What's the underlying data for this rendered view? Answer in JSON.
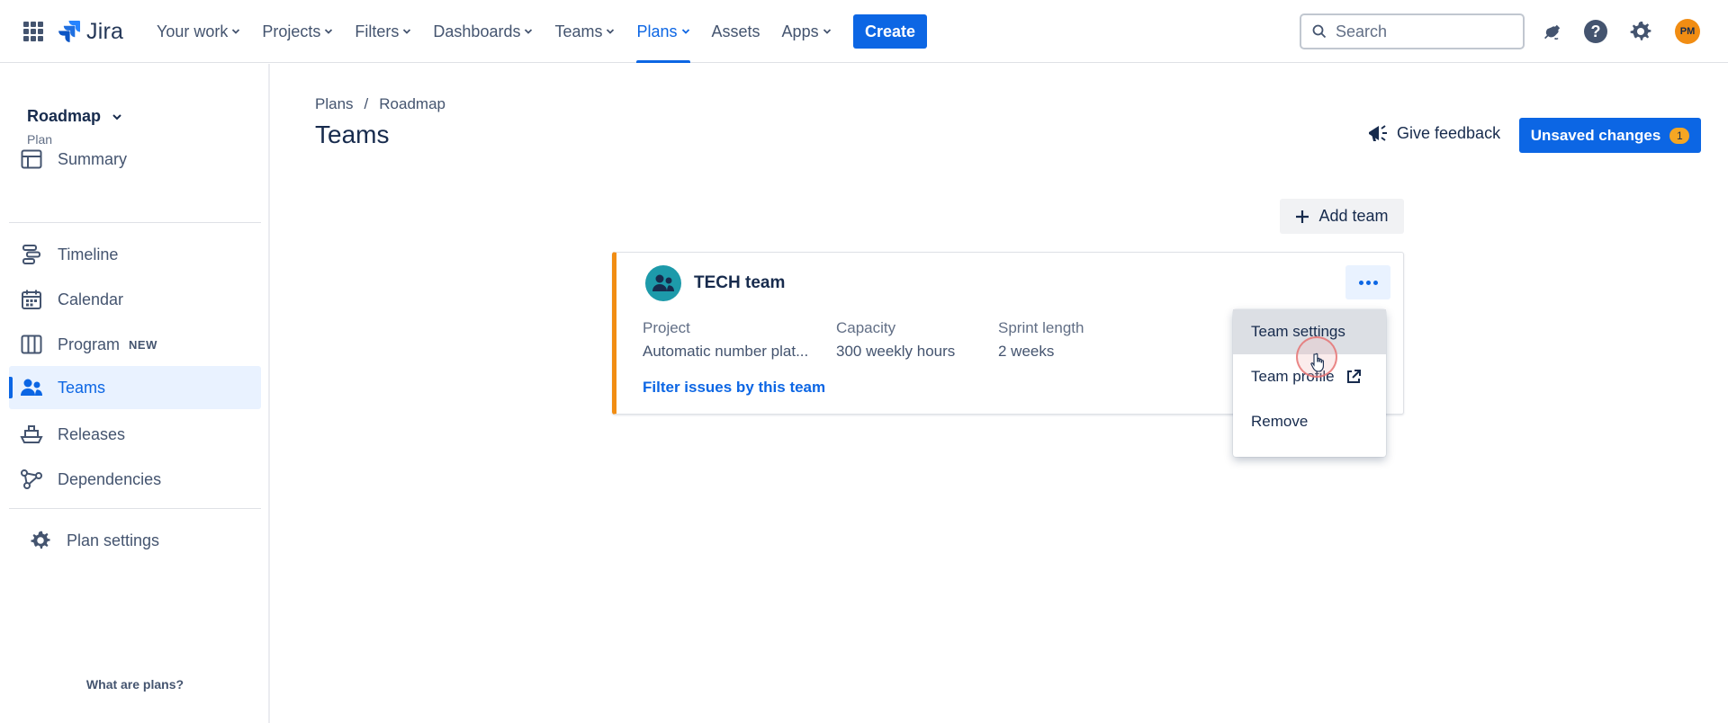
{
  "app": {
    "logo": "Jira"
  },
  "nav": {
    "items": [
      {
        "label": "Your work",
        "chevron": true
      },
      {
        "label": "Projects",
        "chevron": true
      },
      {
        "label": "Filters",
        "chevron": true
      },
      {
        "label": "Dashboards",
        "chevron": true
      },
      {
        "label": "Teams",
        "chevron": true
      },
      {
        "label": "Plans",
        "chevron": true,
        "active": true
      },
      {
        "label": "Assets",
        "chevron": false
      },
      {
        "label": "Apps",
        "chevron": true
      }
    ],
    "create_label": "Create",
    "search_placeholder": "Search",
    "avatar_initials": "PM"
  },
  "sidebar": {
    "project_name": "Roadmap",
    "project_type": "Plan",
    "items": [
      {
        "label": "Summary",
        "icon": "summary-icon"
      },
      {
        "label": "Timeline",
        "icon": "timeline-icon"
      },
      {
        "label": "Calendar",
        "icon": "calendar-icon"
      },
      {
        "label": "Program",
        "icon": "program-icon",
        "badge": "NEW"
      },
      {
        "label": "Teams",
        "icon": "teams-icon",
        "active": true
      },
      {
        "label": "Releases",
        "icon": "releases-icon"
      },
      {
        "label": "Dependencies",
        "icon": "dependencies-icon"
      }
    ],
    "settings_label": "Plan settings",
    "footer_link": "What are plans?"
  },
  "main": {
    "breadcrumb": [
      "Plans",
      "Roadmap"
    ],
    "breadcrumb_separator": "/",
    "title": "Teams",
    "feedback_label": "Give feedback",
    "unsaved_label": "Unsaved changes",
    "unsaved_count": "1",
    "add_team_label": "Add team"
  },
  "team_card": {
    "name": "TECH team",
    "fields": [
      {
        "label": "Project",
        "value": "Automatic number plat..."
      },
      {
        "label": "Capacity",
        "value": "300 weekly hours"
      },
      {
        "label": "Sprint length",
        "value": "2 weeks"
      }
    ],
    "filter_link": "Filter issues by this team"
  },
  "menu": {
    "items": [
      {
        "label": "Team settings",
        "hover": true
      },
      {
        "label": "Team profile",
        "external": true
      },
      {
        "label": "Remove"
      }
    ]
  },
  "colors": {
    "accent": "#0c66e4",
    "team_stripe": "#f18d13",
    "avatar_bg": "#f18d13",
    "team_avatar_bg": "#1d9aaa"
  }
}
